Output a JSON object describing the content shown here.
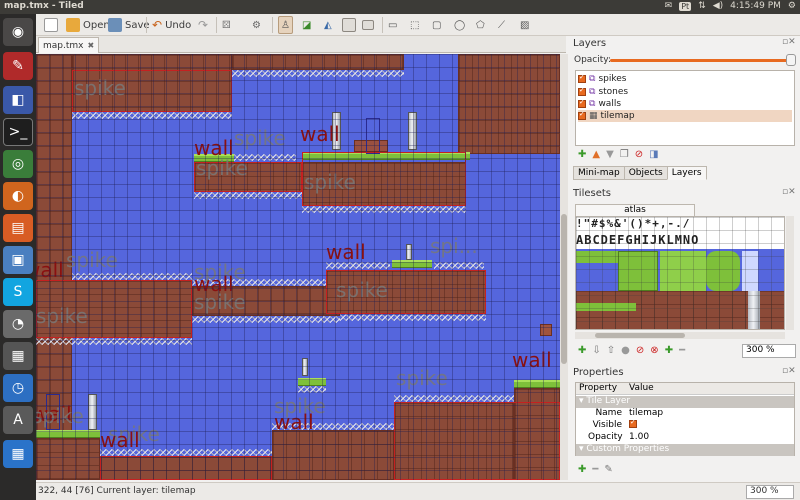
{
  "window": {
    "title": "map.tmx - Tiled"
  },
  "topbar": {
    "keyboard": "Pt",
    "time": "4:15:49 PM"
  },
  "launcher": {
    "apps": [
      "dash-home",
      "pinta",
      "remote-desktop",
      "terminal",
      "chrome",
      "firefox",
      "files",
      "virtualbox",
      "skype",
      "screenshot",
      "calculator",
      "time-sync",
      "update-manager",
      "tiled"
    ]
  },
  "toolbar": {
    "new_label": "",
    "open_label": "Open",
    "save_label": "Save",
    "undo_label": "Undo"
  },
  "document": {
    "tab_label": "map.tmx",
    "close_symbol": "✖"
  },
  "canvas": {
    "objects": [
      {
        "type": "spike",
        "label": "spike"
      },
      {
        "type": "spike",
        "label": "spike"
      },
      {
        "type": "wall",
        "label": "wall"
      },
      {
        "type": "wall",
        "label": "wall"
      },
      {
        "type": "spike",
        "label": "spike"
      },
      {
        "type": "spike",
        "label": "spike"
      },
      {
        "type": "wall",
        "label": "wall"
      },
      {
        "type": "spike",
        "label": "spi..."
      },
      {
        "type": "wall",
        "label": "wall"
      },
      {
        "type": "spike",
        "label": "spike"
      },
      {
        "type": "spike",
        "label": "spike"
      },
      {
        "type": "wall",
        "label": "wall"
      },
      {
        "type": "spike",
        "label": "spike"
      },
      {
        "type": "spike",
        "label": "spike"
      },
      {
        "type": "spike",
        "label": "spike"
      },
      {
        "type": "wall",
        "label": "wall"
      },
      {
        "type": "spike",
        "label": "spike"
      },
      {
        "type": "spike",
        "label": "spike"
      },
      {
        "type": "wall",
        "label": "wall"
      },
      {
        "type": "spike",
        "label": "spike"
      },
      {
        "type": "wall",
        "label": "wall"
      },
      {
        "type": "wall",
        "label": "wall"
      },
      {
        "type": "spike",
        "label": "spike"
      }
    ]
  },
  "status": {
    "text": "322, 44 [76]  Current layer: tilemap",
    "zoom": "300 %"
  },
  "layers_panel": {
    "title": "Layers",
    "opacity_label": "Opacity:",
    "opacity_value": 100,
    "layers": [
      {
        "name": "spikes",
        "visible": true,
        "kind": "object"
      },
      {
        "name": "stones",
        "visible": true,
        "kind": "object"
      },
      {
        "name": "walls",
        "visible": true,
        "kind": "object"
      },
      {
        "name": "tilemap",
        "visible": true,
        "kind": "tile",
        "selected": true
      }
    ],
    "tabs": [
      "Mini-map",
      "Objects",
      "Layers"
    ],
    "active_tab": "Layers"
  },
  "tilesets_panel": {
    "title": "Tilesets",
    "tab": "atlas",
    "zoom": "300 %"
  },
  "properties_panel": {
    "title": "Properties",
    "header": {
      "property": "Property",
      "value": "Value"
    },
    "group_tile_layer": "Tile Layer",
    "rows": [
      {
        "name": "Name",
        "value": "tilemap"
      },
      {
        "name": "Visible",
        "value": ""
      },
      {
        "name": "Opacity",
        "value": "1.00"
      }
    ],
    "group_custom": "Custom Properties"
  },
  "colors": {
    "sky": "#5566dd",
    "dirt": "#8b4a38",
    "grass": "#7ec03a",
    "wall_label": "#8a1010",
    "selection": "#e86a20"
  }
}
